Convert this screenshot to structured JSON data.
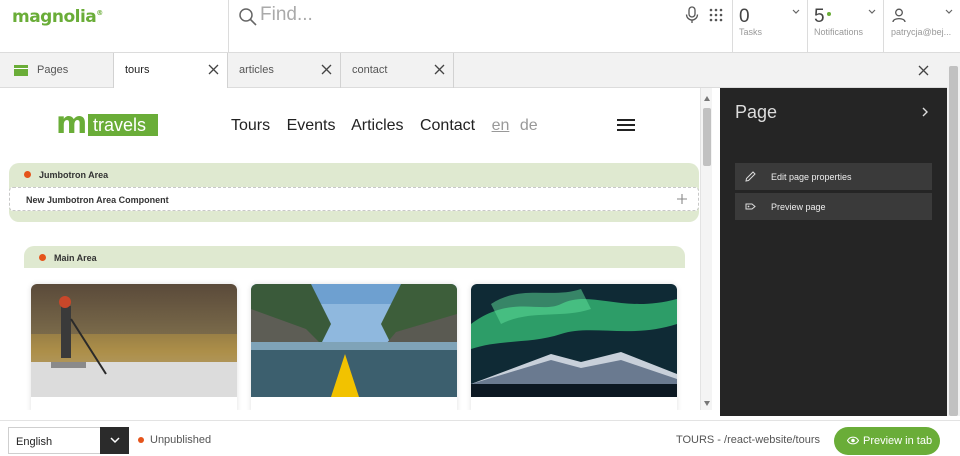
{
  "app": {
    "logo": "magnolia",
    "logo_mark": "®"
  },
  "search": {
    "placeholder": "Find..."
  },
  "counters": {
    "tasks": {
      "value": "0",
      "label": "Tasks"
    },
    "notifications": {
      "value": "5",
      "label": "Notifications"
    },
    "user": {
      "label": "patrycja@bej..."
    }
  },
  "tabs": [
    {
      "label": "Pages",
      "icon": "pages-icon"
    },
    {
      "label": "tours"
    },
    {
      "label": "articles"
    },
    {
      "label": "contact"
    }
  ],
  "site": {
    "logo_m": "m",
    "logo_text": "travels",
    "nav": [
      "Tours",
      "Events",
      "Articles",
      "Contact"
    ],
    "lang_en": "en",
    "lang_de": "de"
  },
  "areas": {
    "jumbotron": {
      "label": "Jumbotron Area",
      "component": "New Jumbotron Area Component"
    },
    "main": {
      "label": "Main Area"
    }
  },
  "panel": {
    "title": "Page",
    "actions": [
      {
        "label": "Edit page properties",
        "icon": "pencil-icon"
      },
      {
        "label": "Preview page",
        "icon": "tag-icon"
      }
    ]
  },
  "footer": {
    "language": "English",
    "status": "Unpublished",
    "path": "TOURS - /react-website/tours",
    "preview_button": "Preview in tab"
  },
  "colors": {
    "brand": "#6aad38",
    "status": "#e5541b",
    "panel": "#252525",
    "area": "#dfe9d0"
  }
}
